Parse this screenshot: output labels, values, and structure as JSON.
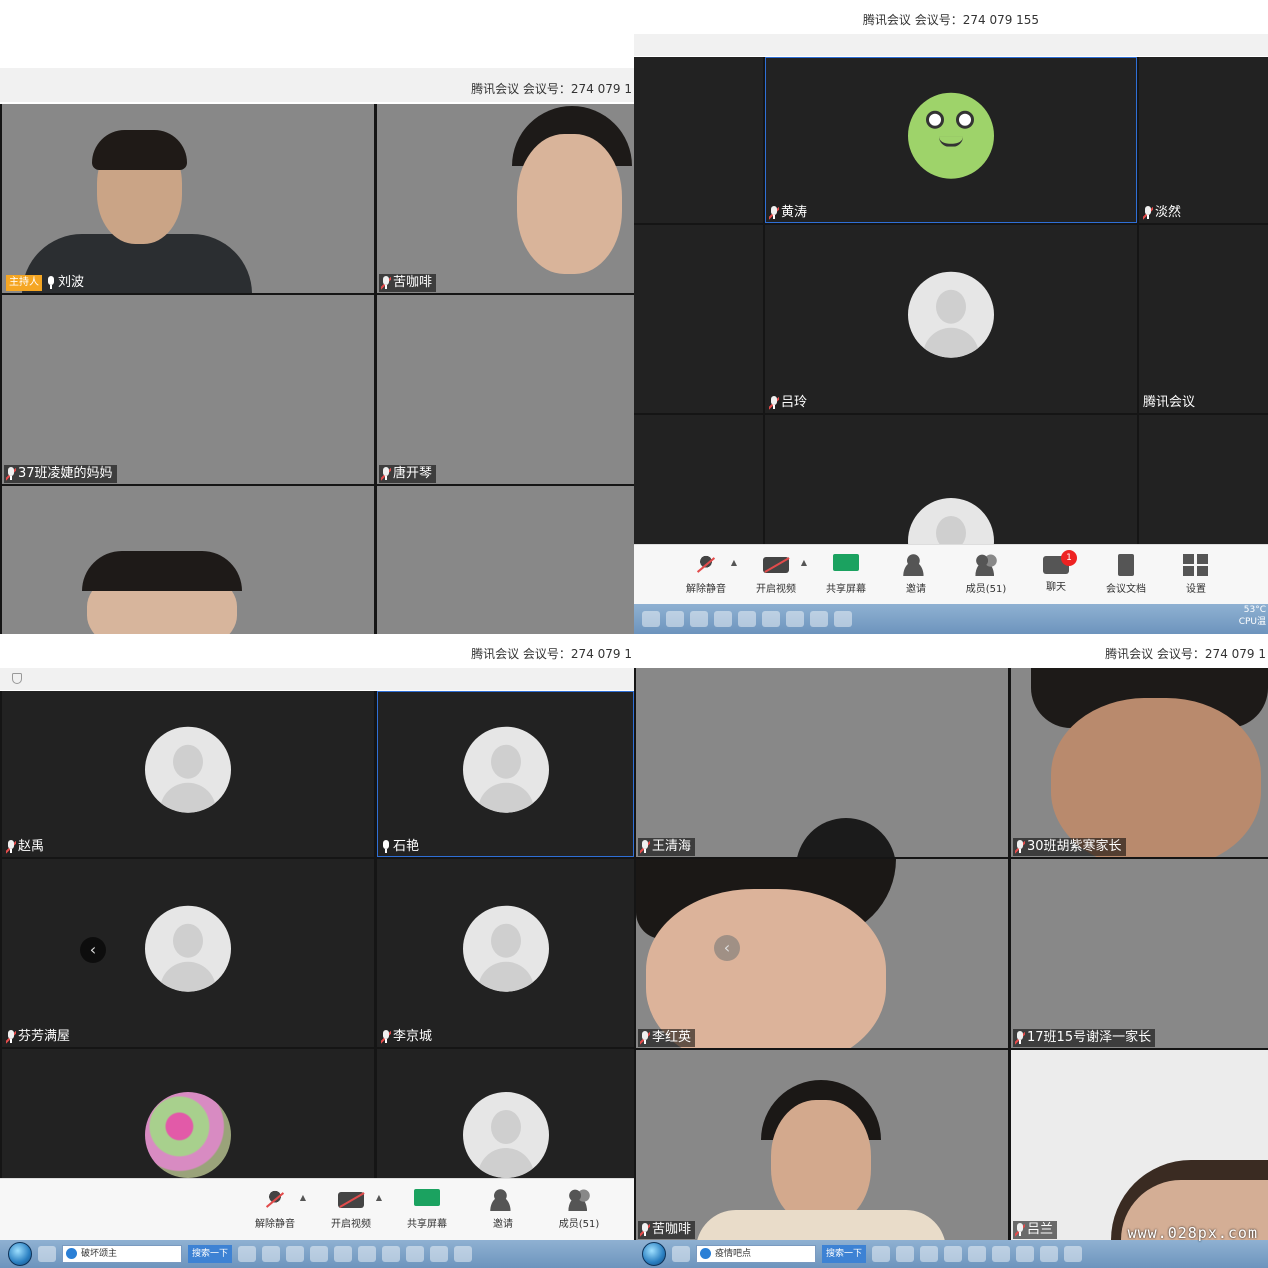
{
  "q1": {
    "title": "腾讯会议 会议号：274 079 1",
    "tiles": [
      {
        "name": "刘波",
        "host_badge": "主持人"
      },
      {
        "name": "苦咖啡"
      },
      {
        "name": "37班凌婕的妈妈"
      },
      {
        "name": "唐开琴"
      },
      {
        "name": ""
      },
      {
        "name": ""
      }
    ]
  },
  "q2": {
    "title": "腾讯会议 会议号：274 079 155",
    "tiles": [
      {
        "name": "黄涛"
      },
      {
        "name": "淡然"
      },
      {
        "name": "吕玲"
      },
      {
        "name": "腾讯会议"
      }
    ],
    "toolbar": {
      "unmute": "解除静音",
      "start_video": "开启视频",
      "share_screen": "共享屏幕",
      "invite": "邀请",
      "members": "成员(51)",
      "chat": "聊天",
      "chat_badge": "1",
      "docs": "会议文档",
      "settings": "设置"
    },
    "tray": {
      "line1": "53°C",
      "line2": "CPU温"
    }
  },
  "q3": {
    "title": "腾讯会议 会议号：274 079 1",
    "tiles": [
      {
        "name": "赵禹"
      },
      {
        "name": "石艳"
      },
      {
        "name": "芬芳满屋"
      },
      {
        "name": "李京城"
      }
    ],
    "toolbar": {
      "unmute": "解除静音",
      "start_video": "开启视频",
      "share_screen": "共享屏幕",
      "invite": "邀请",
      "members": "成员(51)"
    },
    "taskbar": {
      "search_text": "破坏颂主",
      "search_button": "搜索一下"
    }
  },
  "q4": {
    "title": "腾讯会议 会议号：274 079 1",
    "tiles": [
      {
        "name": "王清海"
      },
      {
        "name": "30班胡紫寒家长"
      },
      {
        "name": "李红英"
      },
      {
        "name": "17班15号谢泽一家长"
      },
      {
        "name": "苦咖啡"
      },
      {
        "name": "吕兰"
      }
    ],
    "taskbar": {
      "search_text": "疫情吧点",
      "search_button": "搜索一下"
    },
    "watermark": "www.028px.com"
  }
}
